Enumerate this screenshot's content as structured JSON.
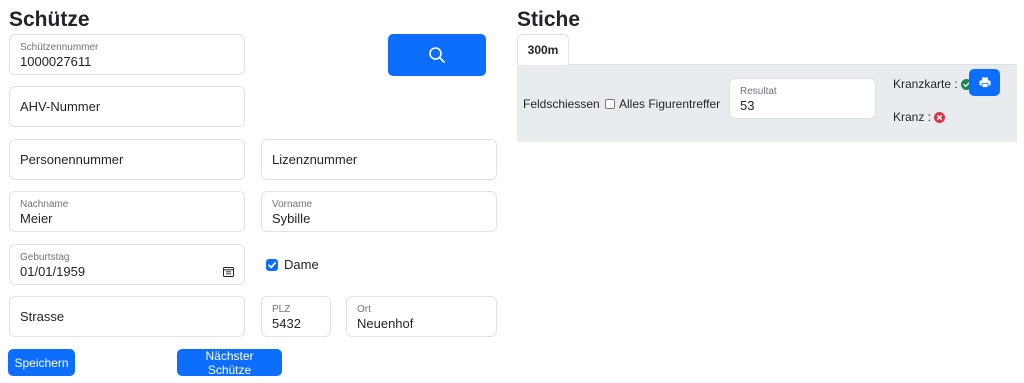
{
  "left": {
    "title": "Schütze",
    "fields": {
      "schuetzennummer": {
        "label": "Schützennummer",
        "value": "1000027611"
      },
      "ahv": {
        "placeholder": "AHV-Nummer"
      },
      "personennummer": {
        "placeholder": "Personennummer"
      },
      "lizenznummer": {
        "placeholder": "Lizenznummer"
      },
      "nachname": {
        "label": "Nachname",
        "value": "Meier"
      },
      "vorname": {
        "label": "Vorname",
        "value": "Sybille"
      },
      "geburtstag": {
        "label": "Geburtstag",
        "value": "01/01/1959"
      },
      "strasse": {
        "placeholder": "Strasse"
      },
      "plz": {
        "label": "PLZ",
        "value": "5432"
      },
      "ort": {
        "label": "Ort",
        "value": "Neuenhof"
      }
    },
    "dame": {
      "label": "Dame",
      "checked": true
    },
    "buttons": {
      "save": "Speichern",
      "next": "Nächster Schütze"
    }
  },
  "right": {
    "title": "Stiche",
    "tabs": [
      {
        "label": "300m",
        "active": true
      }
    ],
    "stich": {
      "name": "Feldschiessen",
      "alle_figurentreffer": {
        "label": "Alles Figurentreffer",
        "checked": false
      },
      "resultat": {
        "label": "Resultat",
        "value": "53"
      },
      "kranzkarte": {
        "label": "Kranzkarte :",
        "status": "ok"
      },
      "kranz": {
        "label": "Kranz :",
        "status": "fail"
      }
    }
  },
  "colors": {
    "primary": "#0d6efd",
    "success": "#198754",
    "danger": "#dc3545",
    "panel": "#e9ecef"
  }
}
